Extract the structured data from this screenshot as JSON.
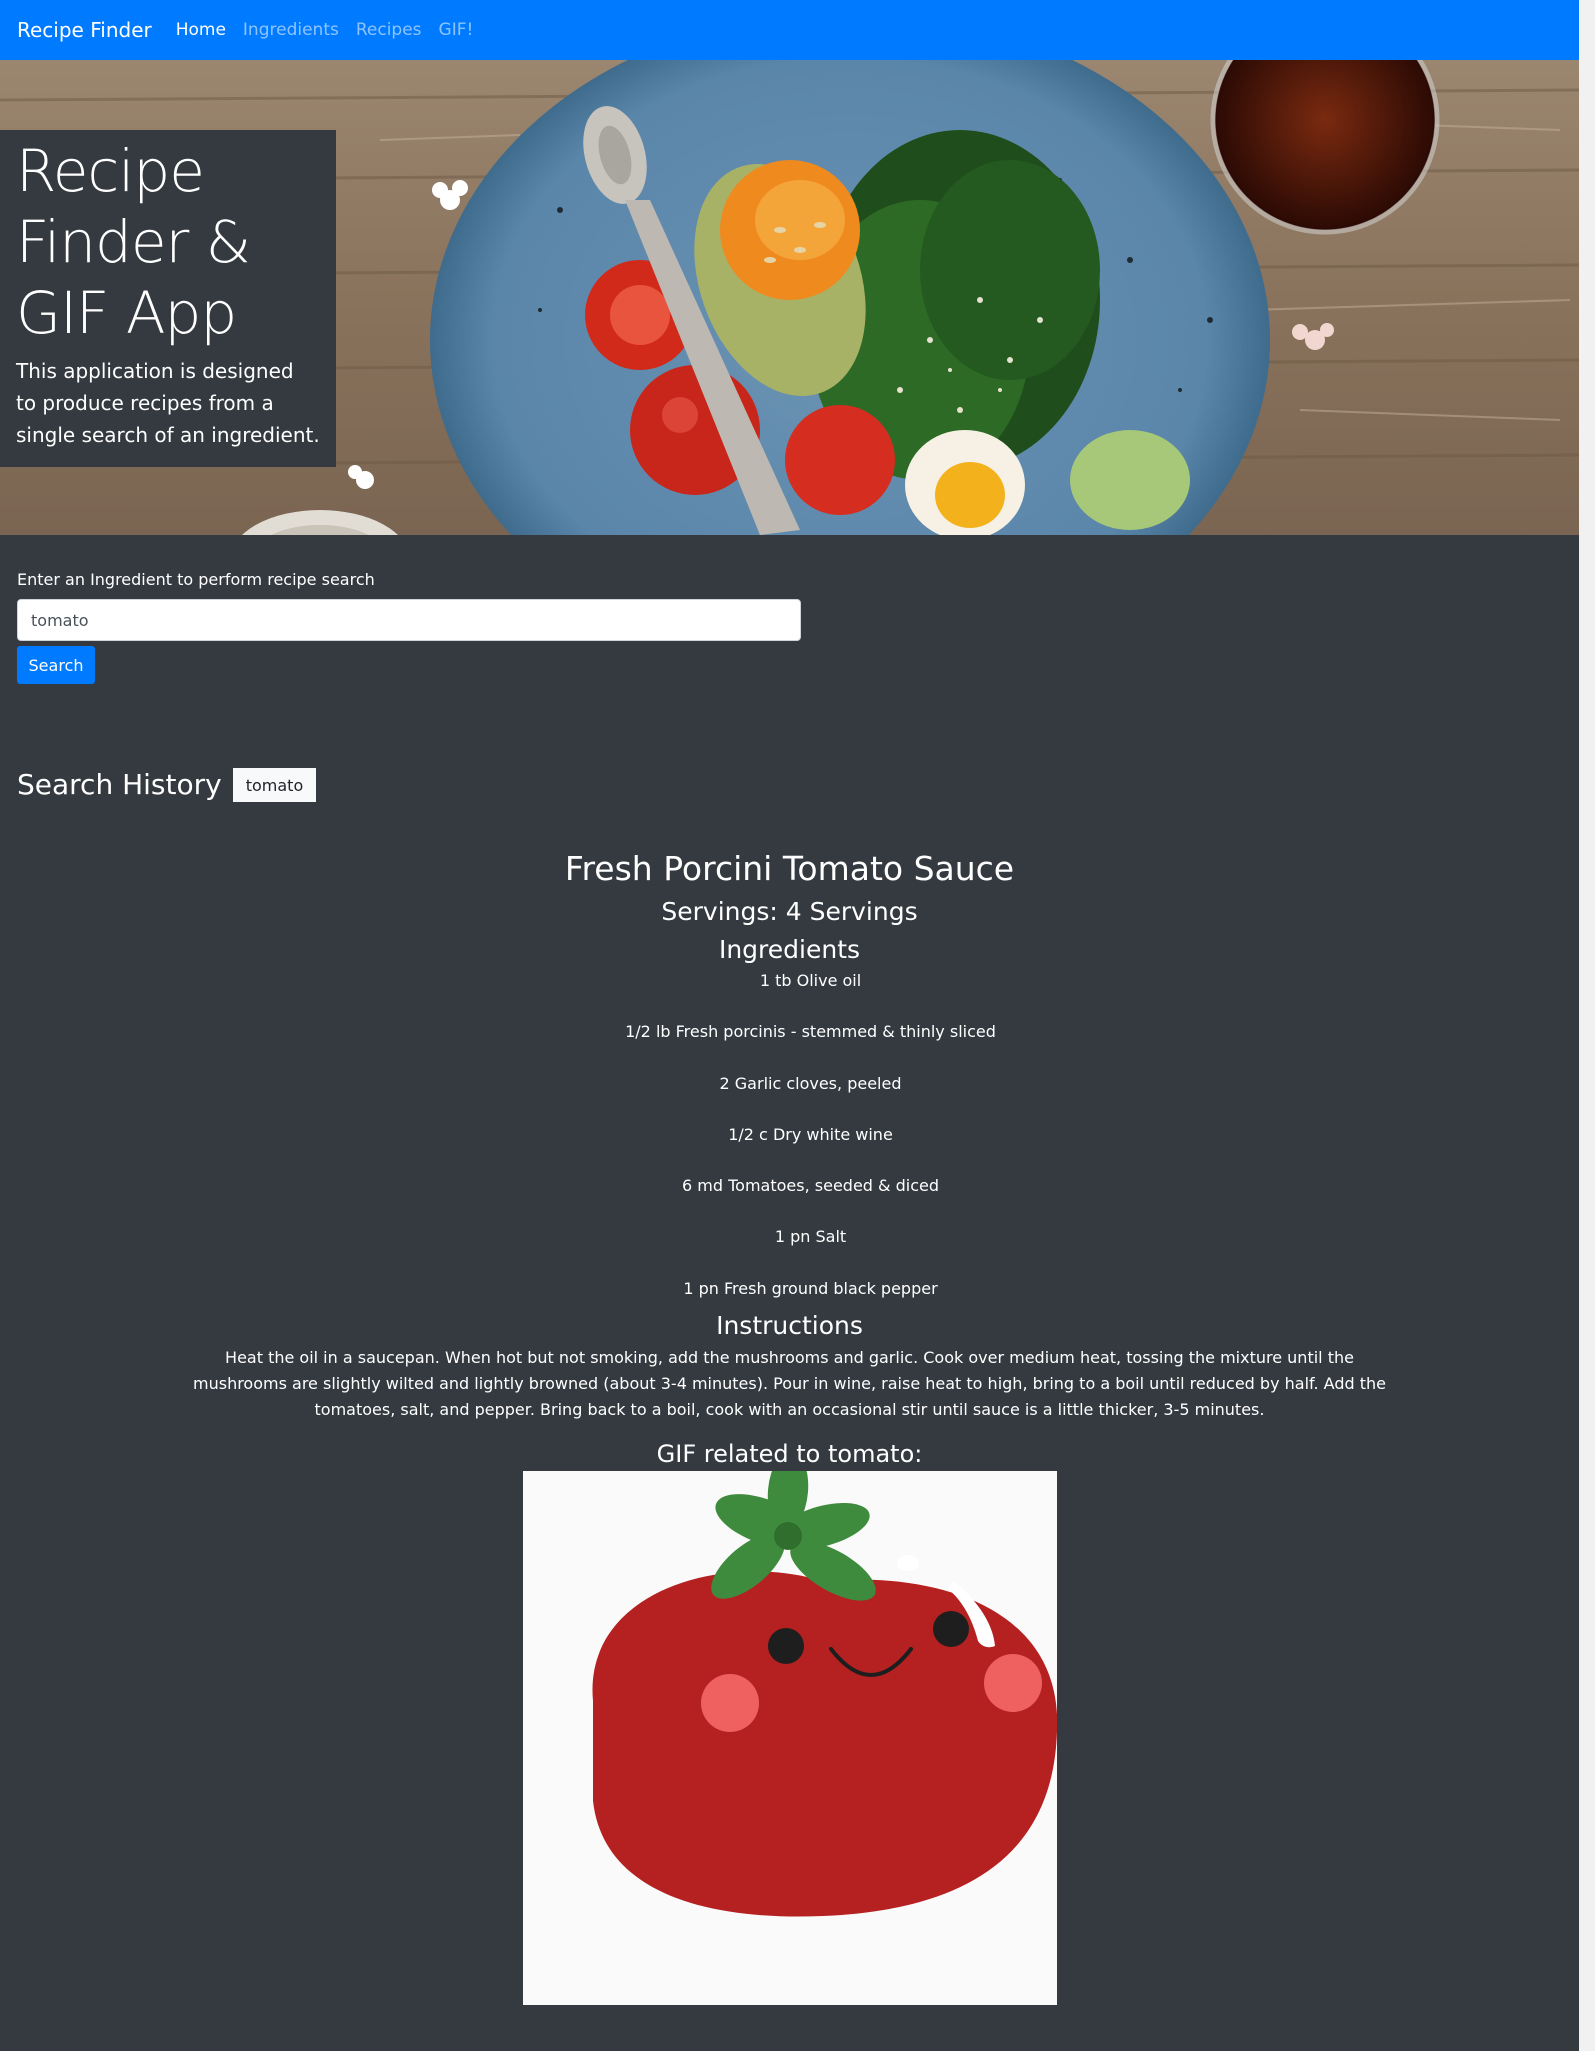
{
  "navbar": {
    "brand": "Recipe Finder",
    "links": [
      {
        "label": "Home",
        "active": true
      },
      {
        "label": "Ingredients",
        "active": false
      },
      {
        "label": "Recipes",
        "active": false
      },
      {
        "label": "GIF!",
        "active": false
      }
    ],
    "color": "#007bff"
  },
  "hero": {
    "title_line1": "Recipe",
    "title_line2": "Finder &",
    "title_line3": "GIF App",
    "lead": "This application is designed to produce recipes from a single search of an ingredient."
  },
  "search": {
    "label": "Enter an Ingredient to perform recipe search",
    "value": "tomato",
    "button_label": "Search"
  },
  "history": {
    "title": "Search History",
    "items": [
      "tomato"
    ]
  },
  "recipe": {
    "title": "Fresh Porcini Tomato Sauce",
    "servings": "Servings: 4 Servings",
    "ingredients_heading": "Ingredients",
    "ingredients": [
      "1 tb Olive oil",
      "1/2 lb Fresh porcinis - stemmed & thinly sliced",
      "2 Garlic cloves, peeled",
      "1/2 c Dry white wine",
      "6 md Tomatoes, seeded & diced",
      "1 pn Salt",
      "1 pn Fresh ground black pepper"
    ],
    "instructions_heading": "Instructions",
    "instructions": "Heat the oil in a saucepan. When hot but not smoking, add the mushrooms and garlic. Cook over medium heat, tossing the mixture until the mushrooms are slightly wilted and lightly browned (about 3-4 minutes). Pour in wine, raise heat to high, bring to a boil until reduced by half. Add the tomatoes, salt, and pepper. Bring back to a boil, cook with an occasional stir until sauce is a little thicker, 3-5 minutes."
  },
  "gif": {
    "heading": "GIF related to tomato:"
  },
  "colors": {
    "background": "#343a40",
    "primary": "#007bff"
  }
}
